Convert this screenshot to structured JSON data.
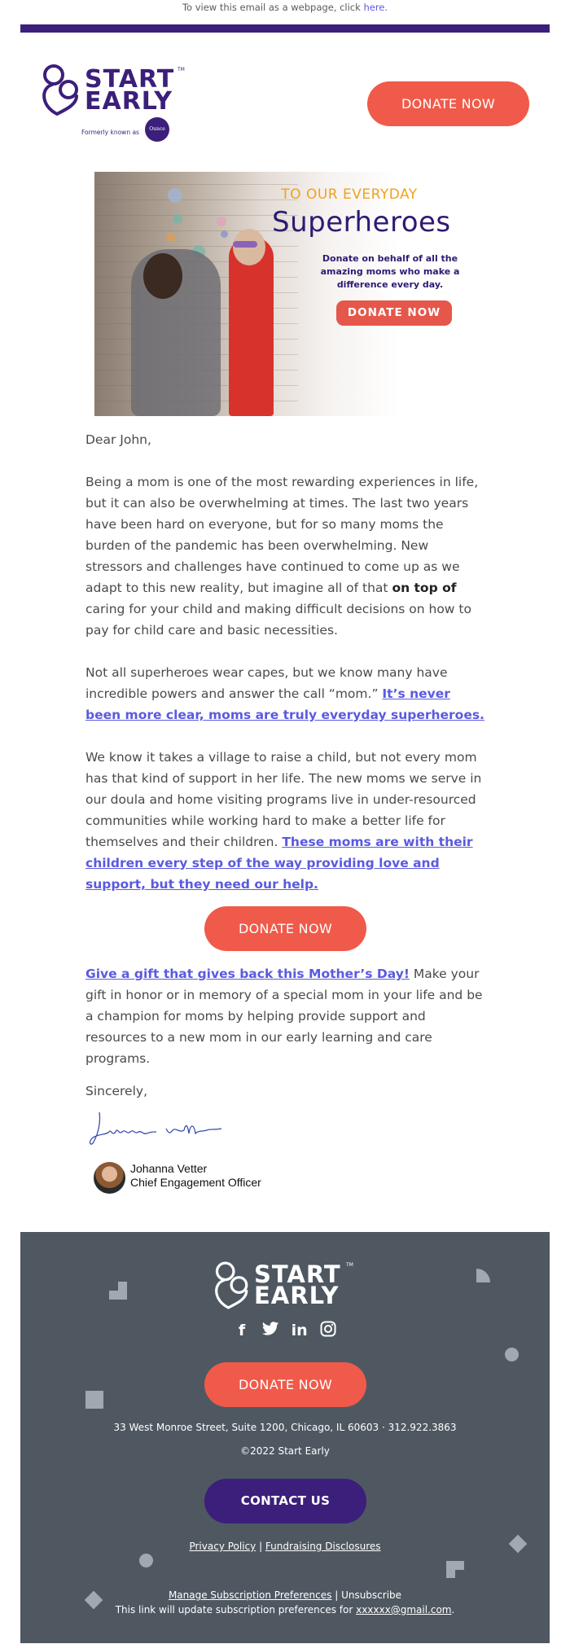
{
  "preheader": {
    "text": "To view this email as a webpage, click ",
    "link_label": "here."
  },
  "colors": {
    "brand_purple": "#3b1f7a",
    "coral": "#f05a4a",
    "link_blue": "#5a5ae0",
    "footer_bg": "#4f5861",
    "hero_orange": "#f0a21c"
  },
  "header": {
    "logo": {
      "line1": "START",
      "line2": "EARLY",
      "tm": "TM",
      "formerly_label": "Formerly known as",
      "former_name": "Ounce"
    },
    "donate_label": "DONATE NOW"
  },
  "hero": {
    "kicker": "TO OUR EVERYDAY",
    "headline": "Superheroes",
    "subtext": "Donate on behalf of all the amazing moms who make a difference every day.",
    "button_label": "DONATE NOW"
  },
  "letter": {
    "greeting": "Dear John,",
    "p1_before": "Being a mom is one of the most rewarding experiences in life, but it can also be overwhelming at times. The last two years have been hard on everyone, but for so many moms the burden of the pandemic has been overwhelming. New stressors and challenges have continued to come up as we adapt to this new reality, but imagine all of that ",
    "p1_bold": "on top of",
    "p1_after": " caring for your child and making difficult decisions on how to pay for child care and basic necessities.",
    "p2_text": "Not all superheroes wear capes, but we know many have incredible powers and answer the call “mom.” ",
    "p2_link": "It’s never been more clear, moms are truly everyday superheroes.",
    "p3_text": "We know it takes a village to raise a child, but not every mom has that kind of support in her life. The new moms we serve in our doula and home visiting programs live in under-resourced communities while working hard to make a better life for themselves and their children. ",
    "p3_link": "These moms are with their children every step of the way providing love and support, but they need our help.",
    "donate_label": "DONATE NOW",
    "p4_link": "Give a gift that gives back this Mother’s Day!",
    "p4_text": " Make your gift in honor or in memory of a special mom in your life and be a champion for moms by helping provide support and resources to a new mom in our early learning and care programs.",
    "closing": "Sincerely,",
    "signature_text": "Johanna vetter",
    "signer_name": "Johanna Vetter",
    "signer_title": "Chief Engagement Officer"
  },
  "footer": {
    "logo": {
      "line1": "START",
      "line2": "EARLY",
      "tm": "TM"
    },
    "socials": [
      {
        "icon": "facebook-icon",
        "glyph": "f"
      },
      {
        "icon": "twitter-icon",
        "glyph": "•"
      },
      {
        "icon": "linkedin-icon",
        "glyph": "in"
      },
      {
        "icon": "instagram-icon",
        "glyph": ""
      }
    ],
    "donate_label": "DONATE NOW",
    "address": "33 West Monroe Street, Suite 1200, Chicago, IL 60603 · 312.922.3863",
    "copyright": "©2022 Start Early",
    "contact_label": "CONTACT US",
    "privacy_label": "Privacy Policy",
    "separator": " | ",
    "fundraising_label": "Fundraising Disclosures",
    "manage_label": "Manage Subscription Preferences",
    "unsubscribe_label": "Unsubscribe",
    "update_text": "This link will update subscription preferences for ",
    "email": "xxxxxx@gmail.com",
    "update_end": "."
  }
}
